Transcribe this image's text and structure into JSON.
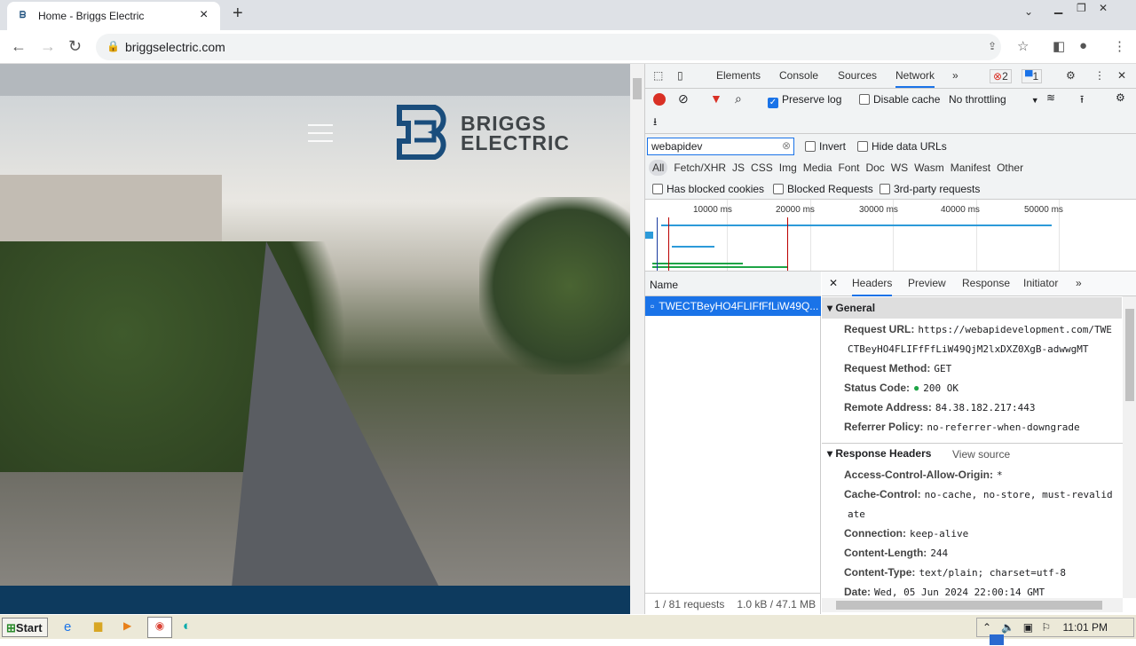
{
  "browser": {
    "tab_title": "Home - Briggs Electric",
    "url": "briggselectric.com"
  },
  "page": {
    "logo_line1": "BRIGGS",
    "logo_line2": "ELECTRIC"
  },
  "devtools": {
    "tabs": [
      "Elements",
      "Console",
      "Sources",
      "Network"
    ],
    "errors_count": "2",
    "messages_count": "1",
    "preserve_log": "Preserve log",
    "disable_cache": "Disable cache",
    "throttling": "No throttling",
    "filter_value": "webapidev",
    "invert": "Invert",
    "hide_data_urls": "Hide data URLs",
    "types": [
      "All",
      "Fetch/XHR",
      "JS",
      "CSS",
      "Img",
      "Media",
      "Font",
      "Doc",
      "WS",
      "Wasm",
      "Manifest",
      "Other"
    ],
    "has_blocked_cookies": "Has blocked cookies",
    "blocked_requests": "Blocked Requests",
    "third_party": "3rd-party requests",
    "timeline_ticks": [
      "10000 ms",
      "20000 ms",
      "30000 ms",
      "40000 ms",
      "50000 ms"
    ],
    "name_header": "Name",
    "request_name": "TWECTBeyHO4FLIFfFfLiW49Q...",
    "status": "1 / 81 requests",
    "transfer": "1.0 kB / 47.1 MB",
    "detail_tabs": [
      "Headers",
      "Preview",
      "Response",
      "Initiator"
    ],
    "general_title": "General",
    "general": [
      {
        "k": "Request URL:",
        "v": "https://webapidevelopment.com/TWE"
      },
      {
        "k": "",
        "v": "CTBeyHO4FLIFfFfLiW49QjM2lxDXZ0XgB-adwwgMT"
      },
      {
        "k": "Request Method:",
        "v": "GET"
      },
      {
        "k": "Status Code:",
        "v": "200 OK"
      },
      {
        "k": "Remote Address:",
        "v": "84.38.182.217:443"
      },
      {
        "k": "Referrer Policy:",
        "v": "no-referrer-when-downgrade"
      }
    ],
    "response_title": "Response Headers",
    "view_source": "View source",
    "response": [
      {
        "k": "Access-Control-Allow-Origin:",
        "v": "*"
      },
      {
        "k": "Cache-Control:",
        "v": "no-cache, no-store, must-revalid"
      },
      {
        "k": "",
        "v": "ate"
      },
      {
        "k": "Connection:",
        "v": "keep-alive"
      },
      {
        "k": "Content-Length:",
        "v": "244"
      },
      {
        "k": "Content-Type:",
        "v": "text/plain; charset=utf-8"
      },
      {
        "k": "Date:",
        "v": "Wed, 05 Jun 2024 22:00:14 GMT"
      }
    ]
  },
  "taskbar": {
    "start": "Start",
    "clock": "11:01 PM"
  }
}
